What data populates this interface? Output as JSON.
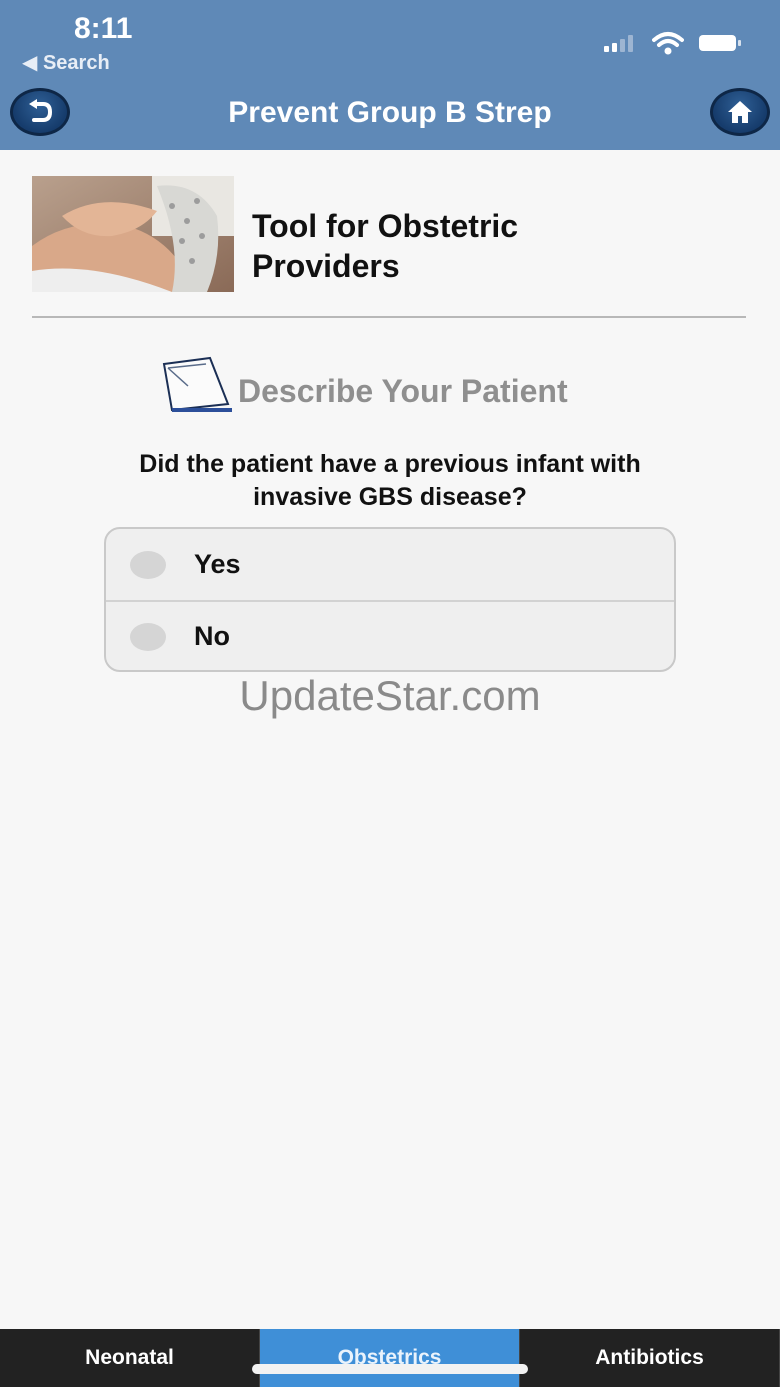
{
  "status": {
    "time": "8:11",
    "back_to_app": "Search"
  },
  "nav": {
    "title": "Prevent Group B Strep"
  },
  "header": {
    "title_line1": "Tool for Obstetric",
    "title_line2": "Providers"
  },
  "section": {
    "title": "Describe Your Patient"
  },
  "question": {
    "line1": "Did the patient have a previous infant with",
    "line2": "invasive GBS disease?",
    "options": [
      {
        "label": "Yes",
        "selected": false
      },
      {
        "label": "No",
        "selected": false
      }
    ]
  },
  "watermark": "UpdateStar.com",
  "tabs": [
    {
      "label": "Neonatal",
      "active": false
    },
    {
      "label": "Obstetrics",
      "active": true
    },
    {
      "label": "Antibiotics",
      "active": false
    }
  ],
  "colors": {
    "header_bg": "#5f89b7",
    "button_bg": "#1d4677",
    "active_tab": "#3f8fd7",
    "tabbar_bg": "#222222"
  },
  "icons": {
    "back": "back-arrow-icon",
    "home": "home-icon",
    "section": "clipboard-icon",
    "signal": "signal-icon",
    "wifi": "wifi-icon",
    "battery": "battery-icon"
  }
}
